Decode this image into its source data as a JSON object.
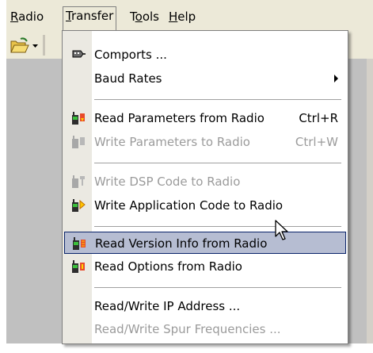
{
  "menubar": {
    "items": [
      {
        "label": "Radio",
        "ul": "R",
        "rest": "adio"
      },
      {
        "label": "Transfer",
        "ul": "T",
        "rest": "ransfer"
      },
      {
        "label": "Tools",
        "pre": "T",
        "ul": "o",
        "rest": "ols"
      },
      {
        "label": "Help",
        "ul": "H",
        "rest": "elp"
      }
    ]
  },
  "menu": {
    "comports": "Comports ...",
    "baud_rates": "Baud Rates",
    "read_params": "Read Parameters from Radio",
    "read_params_sc": "Ctrl+R",
    "write_params": "Write Parameters to Radio",
    "write_params_sc": "Ctrl+W",
    "write_dsp": "Write DSP Code to Radio",
    "write_app": "Write Application Code to Radio",
    "read_version": "Read Version Info from Radio",
    "read_options": "Read Options from Radio",
    "rw_ip": "Read/Write IP Address ...",
    "rw_spur": "Read/Write Spur Frequencies ..."
  },
  "colors": {
    "highlight": "#b6bdd2",
    "disabled_text": "#9b9b9b",
    "menu_bg": "#ffffff"
  }
}
